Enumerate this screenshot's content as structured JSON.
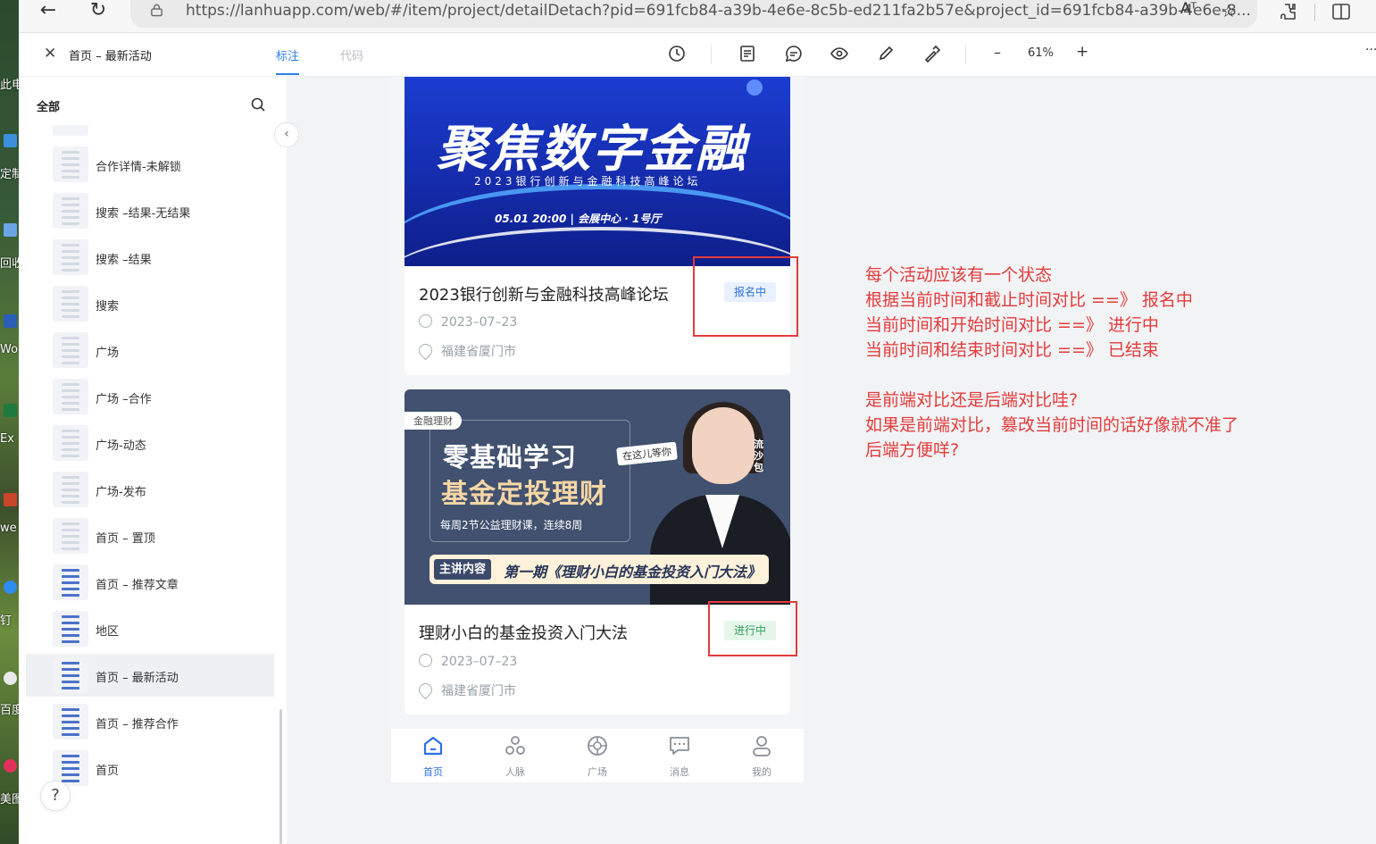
{
  "browser": {
    "url": "https://lanhuapp.com/web/#/item/project/detailDetach?pid=691fcb84-a39b-4e6e-8c5b-ed211fa2b57e&project_id=691fcb84-a39b-4e6e-8...",
    "read_aloud": "Aᵀ"
  },
  "desktop": {
    "labels": [
      "此电",
      "定制",
      "回收",
      "Wo",
      "Ex",
      "we",
      "钉",
      "百度",
      "美图"
    ]
  },
  "toolbar": {
    "title": "首页 – 最新活动",
    "tabs": [
      {
        "label": "标注",
        "active": true
      },
      {
        "label": "代码",
        "active": false
      }
    ],
    "zoom": "61%",
    "zoom_minus": "–",
    "zoom_plus": "+",
    "more": "···"
  },
  "sidebar": {
    "header": "全部",
    "items": [
      {
        "label": "合作详情-未解锁",
        "thumb": "gray"
      },
      {
        "label": "搜索 –结果-无结果",
        "thumb": "gray"
      },
      {
        "label": "搜索 –结果",
        "thumb": "gray"
      },
      {
        "label": "搜索",
        "thumb": "gray"
      },
      {
        "label": "广场",
        "thumb": "gray"
      },
      {
        "label": "广场 –合作",
        "thumb": "gray"
      },
      {
        "label": "广场-动态",
        "thumb": "gray"
      },
      {
        "label": "广场-发布",
        "thumb": "gray"
      },
      {
        "label": "首页 – 置顶",
        "thumb": "gray"
      },
      {
        "label": "首页 – 推荐文章",
        "thumb": "blue"
      },
      {
        "label": "地区",
        "thumb": "blue"
      },
      {
        "label": "首页 – 最新活动",
        "thumb": "blue",
        "active": true
      },
      {
        "label": "首页 – 推荐合作",
        "thumb": "blue"
      },
      {
        "label": "首页",
        "thumb": "blue"
      }
    ],
    "help": "?"
  },
  "events": [
    {
      "banner_title": "聚焦数字金融",
      "banner_subtitle": "2023银行创新与金融科技高峰论坛",
      "banner_info": "05.01  20:00  |  会展中心 · 1号厅",
      "title": "2023银行创新与金融科技高峰论坛",
      "date": "2023–07–23",
      "location": "福建省厦门市",
      "status": "报名中"
    },
    {
      "banner_tag": "金融理财",
      "banner_line1": "零基础学习",
      "banner_line2": "基金定投理财",
      "banner_line3": "每周2节公益理财课，连续8周",
      "banner_chip": "在这儿等你",
      "banner_side": "流沙包",
      "banner_bar_key": "主讲内容",
      "banner_bar_text": "第一期《理财小白的基金投资入门大法》",
      "title": "理财小白的基金投资入门大法",
      "date": "2023–07–23",
      "location": "福建省厦门市",
      "status": "进行中"
    }
  ],
  "tabbar": [
    {
      "label": "首页",
      "icon": "home-icon",
      "active": true
    },
    {
      "label": "人脉",
      "icon": "contacts-icon"
    },
    {
      "label": "广场",
      "icon": "plaza-icon"
    },
    {
      "label": "消息",
      "icon": "message-icon"
    },
    {
      "label": "我的",
      "icon": "profile-icon"
    }
  ],
  "annotation": {
    "text": "每个活动应该有一个状态\n根据当前时间和截止时间对比 ==》 报名中\n当前时间和开始时间对比 ==》 进行中\n当前时间和结束时间对比 ==》 已结束\n\n是前端对比还是后端对比哇?\n如果是前端对比，篡改当前时间的话好像就不准了\n后端方便咩?",
    "color": "#e33b3b"
  },
  "colors": {
    "accent": "#2c7de8",
    "status_registering": "#2d6fe0",
    "status_ongoing": "#2ba158"
  }
}
